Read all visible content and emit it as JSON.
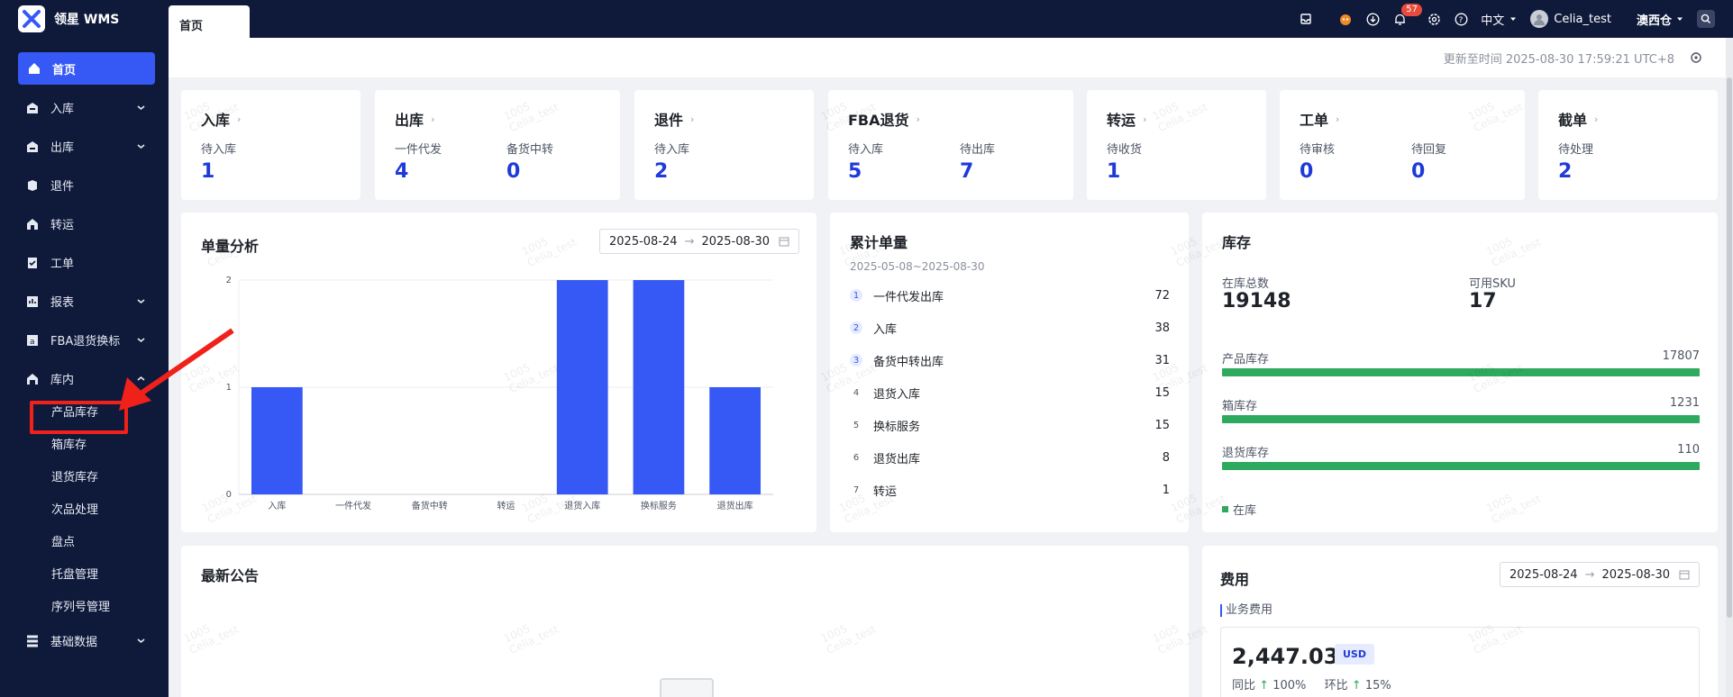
{
  "app": {
    "name": "领星 WMS"
  },
  "sidebar": {
    "items": [
      {
        "label": "首页",
        "icon": "home-icon",
        "active": true
      },
      {
        "label": "入库",
        "icon": "inbound-icon",
        "expandable": true
      },
      {
        "label": "出库",
        "icon": "outbound-icon",
        "expandable": true
      },
      {
        "label": "退件",
        "icon": "return-icon"
      },
      {
        "label": "转运",
        "icon": "transfer-icon"
      },
      {
        "label": "工单",
        "icon": "workorder-icon"
      },
      {
        "label": "报表",
        "icon": "report-icon",
        "expandable": true
      },
      {
        "label": "FBA退货换标",
        "icon": "fba-icon",
        "expandable": true
      },
      {
        "label": "库内",
        "icon": "warehouse-icon",
        "expanded": true
      }
    ],
    "subitems": [
      "产品库存",
      "箱库存",
      "退货库存",
      "次品处理",
      "盘点",
      "托盘管理",
      "序列号管理"
    ],
    "bottom_item": {
      "label": "基础数据",
      "icon": "data-icon",
      "expandable": true
    }
  },
  "topbar": {
    "tab": "首页",
    "notification_count": "57",
    "language": "中文",
    "user": "Celia_test",
    "warehouse": "澳西仓"
  },
  "update": {
    "text": "更新至时间 2025-08-30 17:59:21 UTC+8"
  },
  "stats": [
    {
      "title": "入库",
      "items": [
        {
          "label": "待入库",
          "value": "1"
        }
      ]
    },
    {
      "title": "出库",
      "items": [
        {
          "label": "一件代发",
          "value": "4"
        },
        {
          "label": "备货中转",
          "value": "0"
        }
      ]
    },
    {
      "title": "退件",
      "items": [
        {
          "label": "待入库",
          "value": "2"
        }
      ]
    },
    {
      "title": "FBA退货",
      "items": [
        {
          "label": "待入库",
          "value": "5"
        },
        {
          "label": "待出库",
          "value": "7"
        }
      ]
    },
    {
      "title": "转运",
      "items": [
        {
          "label": "待收货",
          "value": "1"
        }
      ]
    },
    {
      "title": "工单",
      "items": [
        {
          "label": "待审核",
          "value": "0"
        },
        {
          "label": "待回复",
          "value": "0"
        }
      ]
    },
    {
      "title": "截单",
      "items": [
        {
          "label": "待处理",
          "value": "2"
        }
      ]
    }
  ],
  "analysis": {
    "title": "单量分析",
    "date_start": "2025-08-24",
    "date_end": "2025-08-30"
  },
  "chart_data": {
    "type": "bar",
    "title": "单量分析",
    "categories": [
      "入库",
      "一件代发",
      "备货中转",
      "转运",
      "退货入库",
      "换标服务",
      "退货出库"
    ],
    "values": [
      1,
      0,
      0,
      0,
      2,
      2,
      1
    ],
    "ylim": [
      0,
      2
    ],
    "yticks": [
      "0",
      "1",
      "2"
    ],
    "grid": true,
    "color": "#3659f5"
  },
  "ranking": {
    "title": "累计单量",
    "range": "2025-05-08~2025-08-30",
    "rows": [
      {
        "rank": "1",
        "label": "一件代发出库",
        "value": "72"
      },
      {
        "rank": "2",
        "label": "入库",
        "value": "38"
      },
      {
        "rank": "3",
        "label": "备货中转出库",
        "value": "31"
      },
      {
        "rank": "4",
        "label": "退货入库",
        "value": "15"
      },
      {
        "rank": "5",
        "label": "换标服务",
        "value": "15"
      },
      {
        "rank": "6",
        "label": "退货出库",
        "value": "8"
      },
      {
        "rank": "7",
        "label": "转运",
        "value": "1"
      }
    ]
  },
  "inventory": {
    "title": "库存",
    "total_label": "在库总数",
    "total_value": "19148",
    "sku_label": "可用SKU",
    "sku_value": "17",
    "bars": [
      {
        "label": "产品库存",
        "value": "17807"
      },
      {
        "label": "箱库存",
        "value": "1231"
      },
      {
        "label": "退货库存",
        "value": "110"
      }
    ],
    "legend": "在库",
    "bar_color": "#2eaa5e"
  },
  "announcement": {
    "title": "最新公告"
  },
  "fees": {
    "title": "费用",
    "date_start": "2025-08-24",
    "date_end": "2025-08-30",
    "label": "业务费用",
    "value": "2,447.03",
    "currency": "USD",
    "yoy_label": "同比",
    "yoy_value": "100%",
    "mom_label": "环比",
    "mom_value": "15%"
  },
  "watermark": {
    "line1": "1005",
    "line2": "Celia_test"
  },
  "colors": {
    "sidebar": "#0f1a3b",
    "accent": "#3659f5",
    "value": "#1f3ad8",
    "green": "#2eaa5e",
    "annotation": "#f0201a"
  }
}
